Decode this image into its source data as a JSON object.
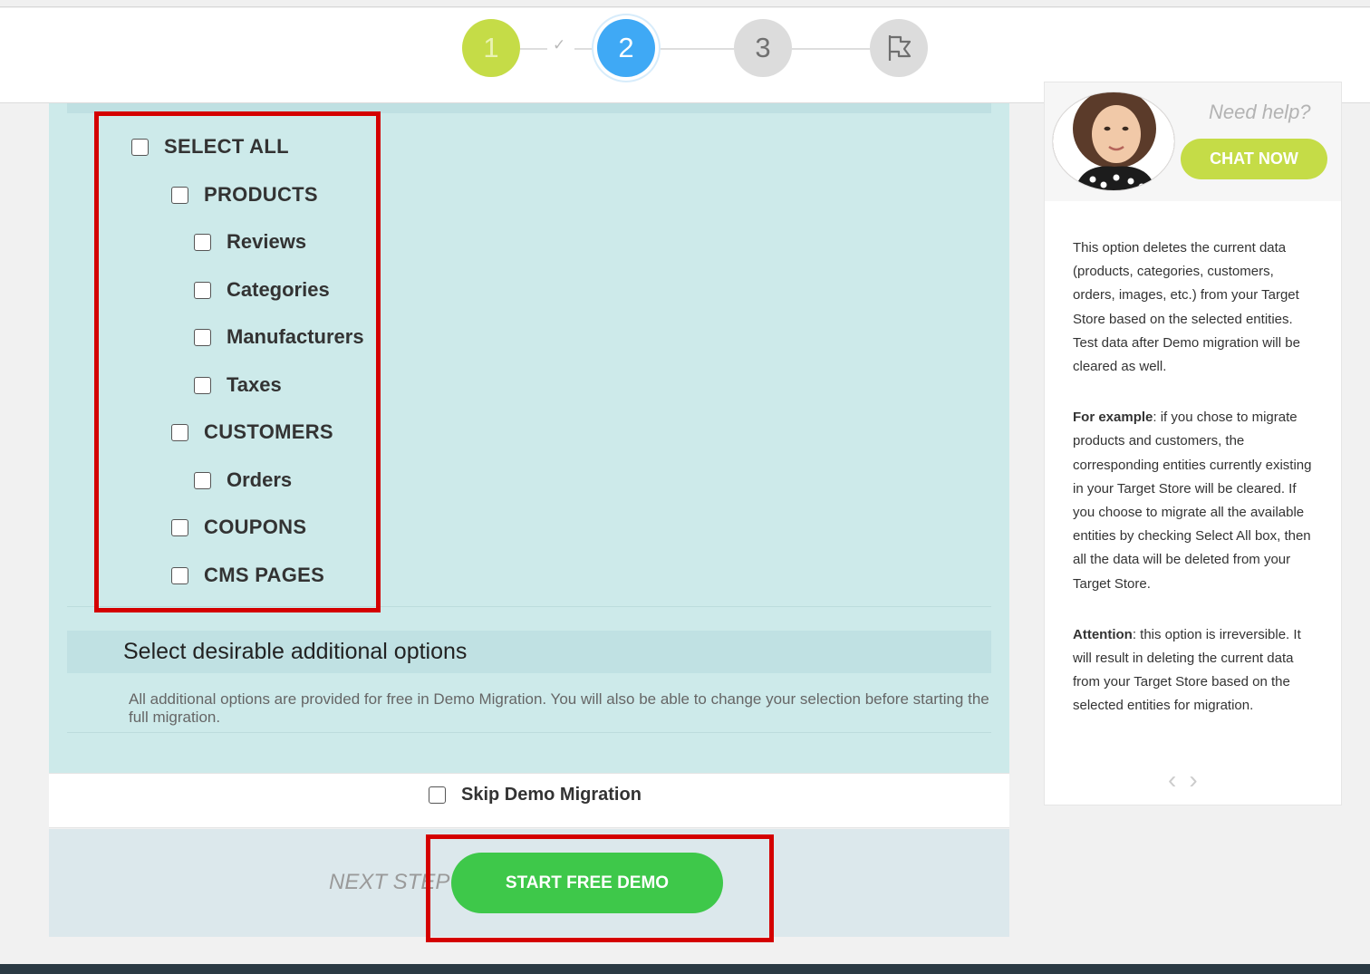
{
  "steps": [
    {
      "number": "1",
      "state": "done"
    },
    {
      "number": "2",
      "state": "current"
    },
    {
      "number": "3",
      "state": "pending"
    },
    {
      "icon": "flag-icon",
      "state": "pending"
    }
  ],
  "entities": {
    "select_all": "SELECT ALL",
    "products": "PRODUCTS",
    "reviews": "Reviews",
    "categories": "Categories",
    "manufacturers": "Manufacturers",
    "taxes": "Taxes",
    "customers": "CUSTOMERS",
    "orders": "Orders",
    "coupons": "COUPONS",
    "cms_pages": "CMS PAGES"
  },
  "additional": {
    "title": "Select desirable additional options",
    "description": "All additional options are provided for free in Demo Migration. You will also be able to change your selection before starting the full migration."
  },
  "skip": {
    "label": "Skip Demo Migration"
  },
  "footer": {
    "next_step": "NEXT STEP",
    "start_button": "START FREE DEMO"
  },
  "help": {
    "need_help": "Need help?",
    "chat_button": "CHAT NOW",
    "para1": "This option deletes the current data (products, categories, customers, orders, images, etc.) from your Target Store based on the selected entities. Test data after Demo migration will be cleared as well.",
    "para2_bold": "For example",
    "para2": ": if you chose to migrate products and customers, the corresponding entities currently existing in your Target Store will be cleared. If you choose to migrate all the available entities by checking Select All box, then all the data will be deleted from your Target Store.",
    "para3_bold": "Attention",
    "para3": ": this option is irreversible. It will result in deleting the current data from your Target Store based on the selected entities for migration."
  },
  "colors": {
    "step_done": "#c5dc47",
    "step_current": "#3fa9f5",
    "primary_button": "#3ec84a",
    "highlight": "#d40000",
    "panel": "#cdeaea"
  }
}
